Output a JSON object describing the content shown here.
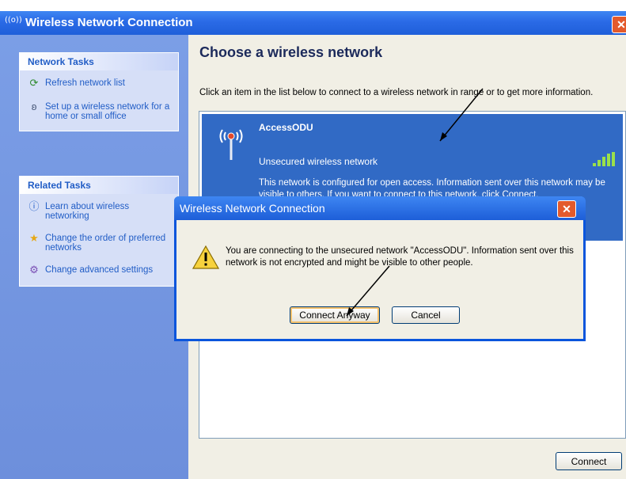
{
  "window": {
    "title": "Wireless Network Connection",
    "icon_text": "((o))",
    "close_glyph": "✕"
  },
  "sidebar": {
    "network_tasks": {
      "header": "Network Tasks",
      "items": [
        {
          "label": "Refresh network list",
          "icon": "refresh-icon"
        },
        {
          "label": "Set up a wireless network for a home or small office",
          "icon": "setup-wireless-icon"
        }
      ]
    },
    "related_tasks": {
      "header": "Related Tasks",
      "items": [
        {
          "label": "Learn about wireless networking",
          "icon": "info-icon"
        },
        {
          "label": "Change the order of preferred networks",
          "icon": "star-icon"
        },
        {
          "label": "Change advanced settings",
          "icon": "settings-icon"
        }
      ]
    }
  },
  "main": {
    "heading": "Choose a wireless network",
    "description": "Click an item in the list below to connect to a wireless network in range or to get more information.",
    "network": {
      "name": "AccessODU",
      "security": "Unsecured wireless network",
      "info": "This network is configured for open access. Information sent over this network may be visible to others. If you want to connect to this network, click Connect."
    },
    "connect_label": "Connect"
  },
  "dialog": {
    "title": "Wireless Network Connection",
    "message": "You are connecting to the unsecured network \"AccessODU\". Information sent over this network is not encrypted and might be visible to other people.",
    "connect_anyway_label": "Connect Anyway",
    "cancel_label": "Cancel",
    "close_glyph": "✕"
  },
  "colors": {
    "titlebar": "#2a6ae6",
    "selection": "#316ac5",
    "sidebar": "#7b9ee6",
    "close": "#e35a2c"
  }
}
